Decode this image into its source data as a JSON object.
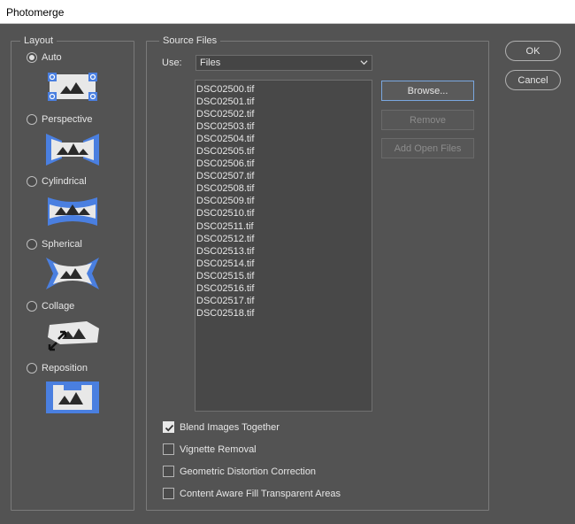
{
  "window": {
    "title": "Photomerge"
  },
  "layout": {
    "legend": "Layout",
    "options": [
      {
        "label": "Auto",
        "checked": true,
        "icon": "auto-layout-icon"
      },
      {
        "label": "Perspective",
        "checked": false,
        "icon": "perspective-layout-icon"
      },
      {
        "label": "Cylindrical",
        "checked": false,
        "icon": "cylindrical-layout-icon"
      },
      {
        "label": "Spherical",
        "checked": false,
        "icon": "spherical-layout-icon"
      },
      {
        "label": "Collage",
        "checked": false,
        "icon": "collage-layout-icon"
      },
      {
        "label": "Reposition",
        "checked": false,
        "icon": "reposition-layout-icon"
      }
    ]
  },
  "source": {
    "legend": "Source Files",
    "use_label": "Use:",
    "use_value": "Files",
    "files": [
      "DSC02500.tif",
      "DSC02501.tif",
      "DSC02502.tif",
      "DSC02503.tif",
      "DSC02504.tif",
      "DSC02505.tif",
      "DSC02506.tif",
      "DSC02507.tif",
      "DSC02508.tif",
      "DSC02509.tif",
      "DSC02510.tif",
      "DSC02511.tif",
      "DSC02512.tif",
      "DSC02513.tif",
      "DSC02514.tif",
      "DSC02515.tif",
      "DSC02516.tif",
      "DSC02517.tif",
      "DSC02518.tif"
    ],
    "buttons": {
      "browse": "Browse...",
      "remove": "Remove",
      "add_open": "Add Open Files"
    },
    "options": [
      {
        "label": "Blend Images Together",
        "checked": true
      },
      {
        "label": "Vignette Removal",
        "checked": false
      },
      {
        "label": "Geometric Distortion Correction",
        "checked": false
      },
      {
        "label": "Content Aware Fill Transparent Areas",
        "checked": false
      }
    ]
  },
  "actions": {
    "ok": "OK",
    "cancel": "Cancel"
  },
  "colors": {
    "background": "#535353",
    "accent": "#4a7fe0",
    "thumb_fill": "#e8e8e8"
  }
}
